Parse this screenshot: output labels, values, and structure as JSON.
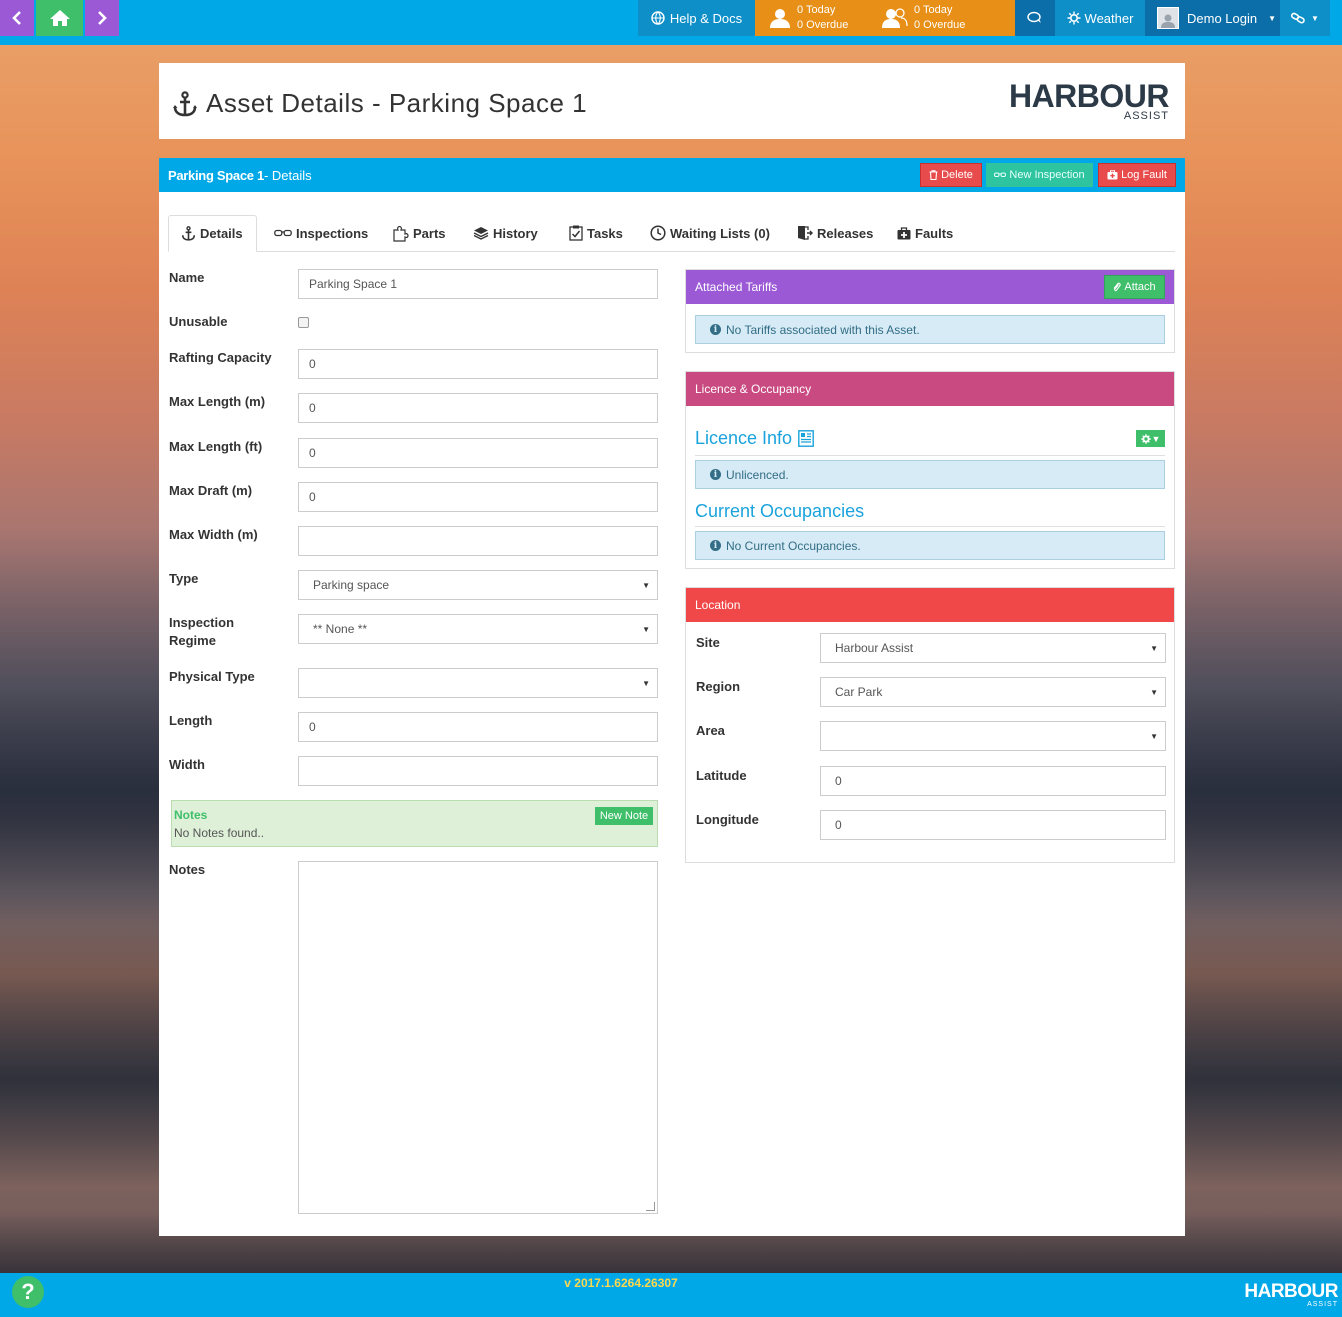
{
  "topbar": {
    "help_label": "Help & Docs",
    "alerts": [
      {
        "line1": "0 Today",
        "line2": "0 Overdue"
      },
      {
        "line1": "0 Today",
        "line2": "0 Overdue"
      }
    ],
    "weather_label": "Weather",
    "user_label": "Demo Login"
  },
  "header": {
    "title": "Asset Details - Parking Space 1",
    "logo_main": "HARBOUR",
    "logo_sub": "ASSIST"
  },
  "panel": {
    "asset_name": "Parking Space 1",
    "suffix": " - Details",
    "delete_label": "Delete",
    "new_inspection_label": "New Inspection",
    "log_fault_label": "Log Fault"
  },
  "tabs": [
    {
      "label": "Details",
      "icon": "anchor-icon"
    },
    {
      "label": "Inspections",
      "icon": "glasses-icon"
    },
    {
      "label": "Parts",
      "icon": "puzzle-icon"
    },
    {
      "label": "History",
      "icon": "layers-icon"
    },
    {
      "label": "Tasks",
      "icon": "checklist-icon"
    },
    {
      "label": "Waiting Lists (0)",
      "icon": "clock-icon"
    },
    {
      "label": "Releases",
      "icon": "exit-icon"
    },
    {
      "label": "Faults",
      "icon": "medkit-icon"
    }
  ],
  "form": {
    "name": {
      "label": "Name",
      "value": "Parking Space 1"
    },
    "unusable": {
      "label": "Unusable"
    },
    "rafting": {
      "label": "Rafting Capacity",
      "value": "0"
    },
    "max_length_m": {
      "label": "Max Length (m)",
      "value": "0"
    },
    "max_length_ft": {
      "label": "Max Length (ft)",
      "value": "0"
    },
    "max_draft": {
      "label": "Max Draft (m)",
      "value": "0"
    },
    "max_width": {
      "label": "Max Width (m)",
      "value": ""
    },
    "type": {
      "label": "Type",
      "value": "Parking space"
    },
    "inspection_regime": {
      "label_1": "Inspection",
      "label_2": "Regime",
      "value": "** None **"
    },
    "physical_type": {
      "label": "Physical Type",
      "value": ""
    },
    "length": {
      "label": "Length",
      "value": "0"
    },
    "width": {
      "label": "Width",
      "value": ""
    },
    "notes_box": {
      "title": "Notes",
      "empty": "No Notes found..",
      "new_note_label": "New Note"
    },
    "notes": {
      "label": "Notes"
    }
  },
  "tariffs": {
    "title": "Attached Tariffs",
    "attach_label": "Attach",
    "empty": "No Tariffs associated with this Asset.",
    "color": "#9b59d6"
  },
  "licence": {
    "title": "Licence & Occupancy",
    "licence_info": "Licence Info",
    "licence_status": "Unlicenced.",
    "occupancies_title": "Current Occupancies",
    "occupancies_empty": "No Current Occupancies.",
    "color": "#c94a80"
  },
  "location": {
    "title": "Location",
    "color": "#f04848",
    "site": {
      "label": "Site",
      "value": "Harbour Assist"
    },
    "region": {
      "label": "Region",
      "value": "Car Park"
    },
    "area": {
      "label": "Area",
      "value": ""
    },
    "latitude": {
      "label": "Latitude",
      "value": "0"
    },
    "longitude": {
      "label": "Longitude",
      "value": "0"
    }
  },
  "footer": {
    "version": "v 2017.1.6264.26307",
    "help_glyph": "?",
    "logo_main": "HARBOUR",
    "logo_sub": "ASSIST"
  }
}
